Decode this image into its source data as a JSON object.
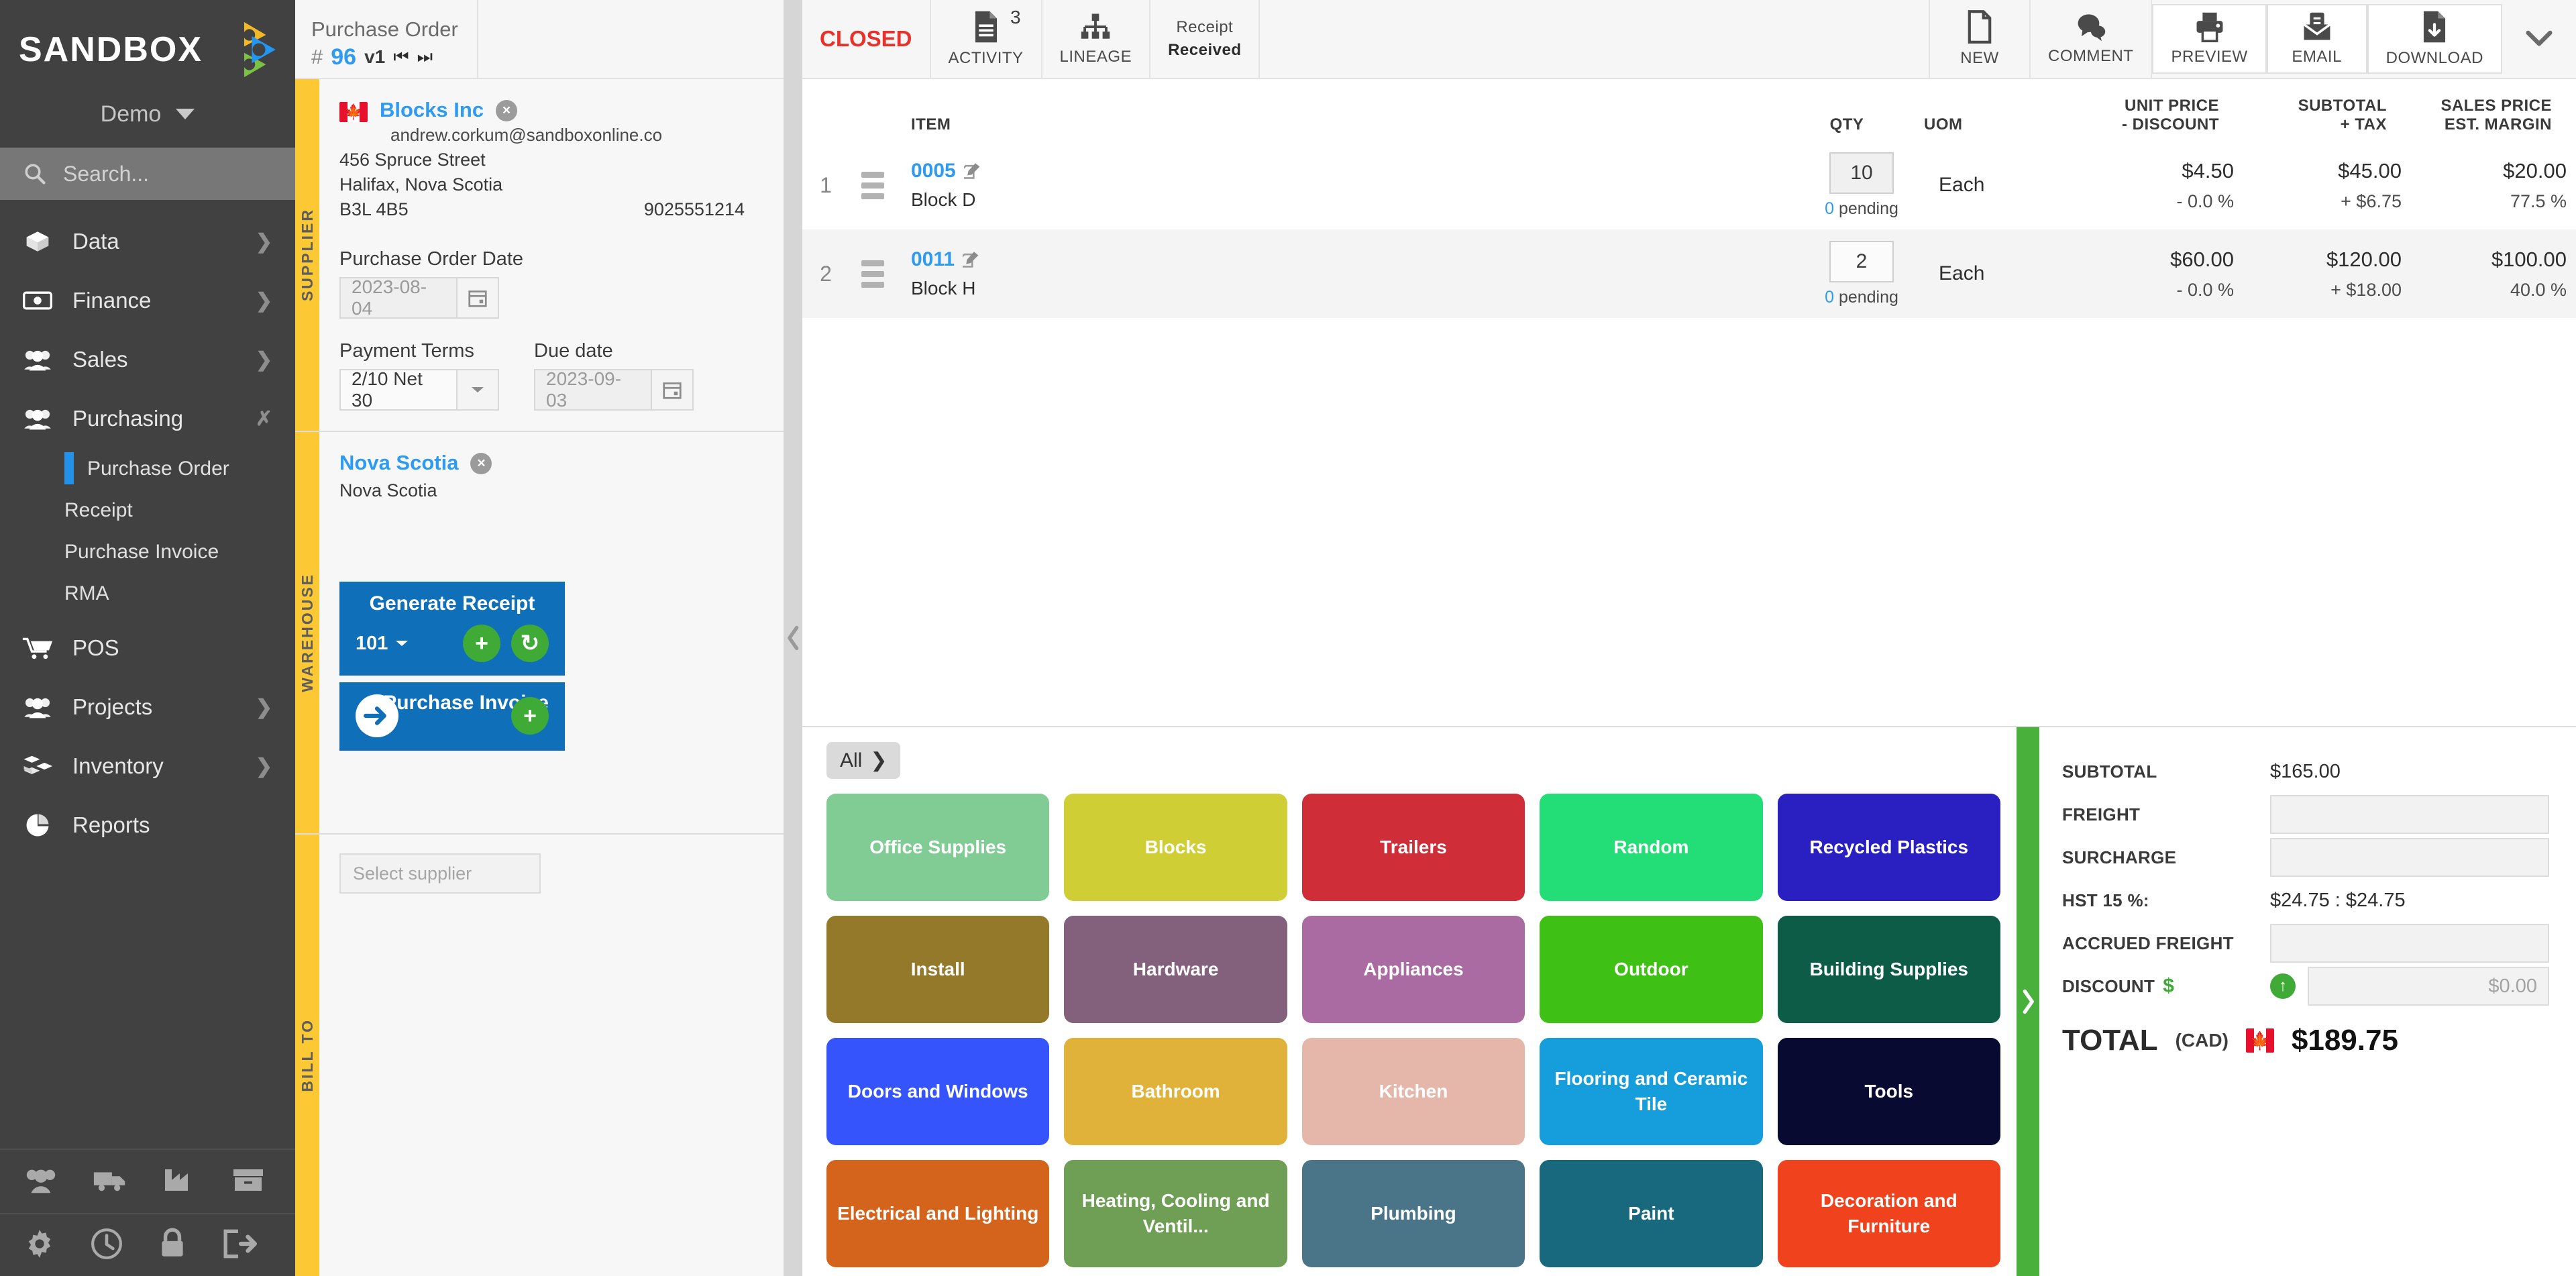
{
  "sidebar": {
    "logo_text": "SANDBOX",
    "org_name": "Demo",
    "search_placeholder": "Search...",
    "items": [
      {
        "label": "Data",
        "icon": "box-icon",
        "expandable": true,
        "expanded": false
      },
      {
        "label": "Finance",
        "icon": "money-icon",
        "expandable": true,
        "expanded": false
      },
      {
        "label": "Sales",
        "icon": "people-icon",
        "expandable": true,
        "expanded": false
      },
      {
        "label": "Purchasing",
        "icon": "people-icon",
        "expandable": true,
        "expanded": true
      },
      {
        "label": "POS",
        "icon": "cart-icon",
        "expandable": false,
        "expanded": false
      },
      {
        "label": "Projects",
        "icon": "people-icon",
        "expandable": true,
        "expanded": false
      },
      {
        "label": "Inventory",
        "icon": "blocks-icon",
        "expandable": true,
        "expanded": false
      },
      {
        "label": "Reports",
        "icon": "pie-chart-icon",
        "expandable": false,
        "expanded": false
      }
    ],
    "purchasing_sub": [
      {
        "label": "Purchase Order",
        "active": true
      },
      {
        "label": "Receipt",
        "active": false
      },
      {
        "label": "Purchase Invoice",
        "active": false
      },
      {
        "label": "RMA",
        "active": false
      }
    ],
    "bottom_icons_row1": [
      "people-icon",
      "truck-icon",
      "factory-icon",
      "archive-box-icon"
    ],
    "bottom_icons_row2": [
      "gear-icon",
      "clock-icon",
      "lock-icon",
      "logout-icon"
    ],
    "accent_active": "#2491e8"
  },
  "header": {
    "doc_title": "Purchase Order",
    "hash": "#",
    "doc_number": "96",
    "version": "v1",
    "prev_label": "⏮",
    "next_label": "⏭",
    "status": "CLOSED",
    "status_color": "#e8312a",
    "activity_count": "3",
    "activity_label": "ACTIVITY",
    "lineage_label": "LINEAGE",
    "receipt_caption": "Receipt",
    "receipt_status": "Received",
    "actions": [
      {
        "label": "NEW",
        "icon": "new-document-icon",
        "card": false
      },
      {
        "label": "COMMENT",
        "icon": "comment-icon",
        "card": false
      },
      {
        "label": "PREVIEW",
        "icon": "printer-icon",
        "card": true
      },
      {
        "label": "EMAIL",
        "icon": "email-icon",
        "card": true
      },
      {
        "label": "DOWNLOAD",
        "icon": "download-document-icon",
        "card": true
      }
    ],
    "more_icon": "chevron-down-icon"
  },
  "supplier": {
    "section_label": "SUPPLIER",
    "country_flag": "canada-flag",
    "name": "Blocks Inc",
    "email": "andrew.corkum@sandboxonline.co",
    "address_line1": "456 Spruce Street",
    "address_line2": "Halifax, Nova Scotia",
    "postal_code": "B3L 4B5",
    "phone": "9025551214",
    "po_date_label": "Purchase Order Date",
    "po_date": "2023-08-04",
    "payment_terms_label": "Payment Terms",
    "payment_terms": "2/10 Net 30",
    "due_date_label": "Due date",
    "due_date": "2023-09-03"
  },
  "warehouse": {
    "section_label": "WAREHOUSE",
    "name": "Nova Scotia",
    "sub": "Nova Scotia",
    "generate_receipt_label": "Generate Receipt",
    "receipt_number": "101",
    "purchase_invoice_label": "Purchase Invoice"
  },
  "bill_to": {
    "section_label": "BILL TO",
    "select_supplier_placeholder": "Select supplier"
  },
  "items": {
    "columns": {
      "item": "ITEM",
      "qty": "QTY",
      "uom": "UOM",
      "unit_price": "UNIT PRICE",
      "discount": "- DISCOUNT",
      "subtotal": "SUBTOTAL",
      "tax": "+ TAX",
      "sales_price": "SALES PRICE",
      "est_margin": "EST. MARGIN"
    },
    "rows": [
      {
        "index": "1",
        "code": "0005",
        "description": "Block D",
        "qty": "10",
        "pending_count": "0",
        "pending_text": "pending",
        "uom": "Each",
        "unit_price": "$4.50",
        "discount": "- 0.0 %",
        "subtotal": "$45.00",
        "tax": "+ $6.75",
        "sales_price": "$20.00",
        "est_margin": "77.5 %"
      },
      {
        "index": "2",
        "code": "0011",
        "description": "Block H",
        "qty": "2",
        "pending_count": "0",
        "pending_text": "pending",
        "uom": "Each",
        "unit_price": "$60.00",
        "discount": "- 0.0 %",
        "subtotal": "$120.00",
        "tax": "+ $18.00",
        "sales_price": "$100.00",
        "est_margin": "40.0 %"
      }
    ]
  },
  "catalog": {
    "all_chip": "All",
    "tiles": [
      {
        "label": "Office Supplies",
        "color": "#81cc95"
      },
      {
        "label": "Blocks",
        "color": "#cfcf35"
      },
      {
        "label": "Trailers",
        "color": "#cf2d38"
      },
      {
        "label": "Random",
        "color": "#23dd76"
      },
      {
        "label": "Recycled Plastics",
        "color": "#2a1fc1"
      },
      {
        "label": "Install",
        "color": "#94792a"
      },
      {
        "label": "Hardware",
        "color": "#83607c"
      },
      {
        "label": "Appliances",
        "color": "#a96ba1"
      },
      {
        "label": "Outdoor",
        "color": "#3ec114"
      },
      {
        "label": "Building Supplies",
        "color": "#0c5c48"
      },
      {
        "label": "Doors and Windows",
        "color": "#3554fb"
      },
      {
        "label": "Bathroom",
        "color": "#e0b23a"
      },
      {
        "label": "Kitchen",
        "color": "#e5b7ab"
      },
      {
        "label": "Flooring and Ceramic Tile",
        "color": "#159ddc"
      },
      {
        "label": "Tools",
        "color": "#080a32"
      },
      {
        "label": "Electrical and Lighting",
        "color": "#d4631c"
      },
      {
        "label": "Heating, Cooling and Ventil...",
        "color": "#6e9f55"
      },
      {
        "label": "Plumbing",
        "color": "#4a7488"
      },
      {
        "label": "Paint",
        "color": "#18697e"
      },
      {
        "label": "Decoration and Furniture",
        "color": "#f0421c"
      }
    ]
  },
  "totals": {
    "subtotal_label": "SUBTOTAL",
    "subtotal_value": "$165.00",
    "freight_label": "FREIGHT",
    "freight_value": "",
    "surcharge_label": "SURCHARGE",
    "surcharge_value": "",
    "hst_label": "HST 15 %:",
    "hst_value": "$24.75 : $24.75",
    "accrued_freight_label": "ACCRUED FREIGHT",
    "accrued_freight_value": "",
    "discount_label": "DISCOUNT",
    "discount_symbol": "$",
    "discount_value": "$0.00",
    "total_label": "TOTAL",
    "total_currency": "(CAD)",
    "total_value": "$189.75",
    "total_flag": "canada-flag",
    "accent_green": "#3faa35"
  }
}
